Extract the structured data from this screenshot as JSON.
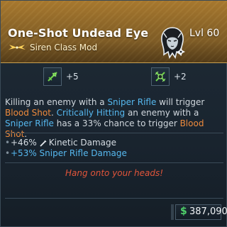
{
  "item": {
    "name": "One-Shot Undead Eye",
    "class_mod": "Siren Class Mod",
    "level": "Lvl 60",
    "rarity_color": "#a7782e"
  },
  "skills": [
    {
      "icon": "sniper-skill-icon",
      "value": "+5"
    },
    {
      "icon": "crossed-skill-icon",
      "value": "+2"
    }
  ],
  "description": {
    "segments": [
      {
        "text": "Killing an enemy with a ",
        "style": "plain"
      },
      {
        "text": "Sniper Rifle",
        "style": "blue"
      },
      {
        "text": " will trigger ",
        "style": "plain"
      },
      {
        "text": "Blood Shot",
        "style": "orange"
      },
      {
        "text": ". ",
        "style": "plain"
      },
      {
        "text": "Critically Hitting",
        "style": "blue"
      },
      {
        "text": " an enemy with a ",
        "style": "plain"
      },
      {
        "text": "Sniper Rifle",
        "style": "blue"
      },
      {
        "text": " has a 33% chance to trigger ",
        "style": "plain"
      },
      {
        "text": "Blood Shot",
        "style": "orange"
      },
      {
        "text": ".",
        "style": "plain"
      }
    ]
  },
  "stats": [
    {
      "bullet": "•",
      "text": "+46% ",
      "icon": "kinetic-damage-icon",
      "label": "Kinetic Damage",
      "style": "plain"
    },
    {
      "bullet": "•",
      "text": "+53% Sniper Rifle Damage",
      "label": "",
      "style": "blue"
    }
  ],
  "flavor_text": "Hang onto your heads!",
  "price": {
    "currency_symbol": "$",
    "value": "387,090"
  }
}
